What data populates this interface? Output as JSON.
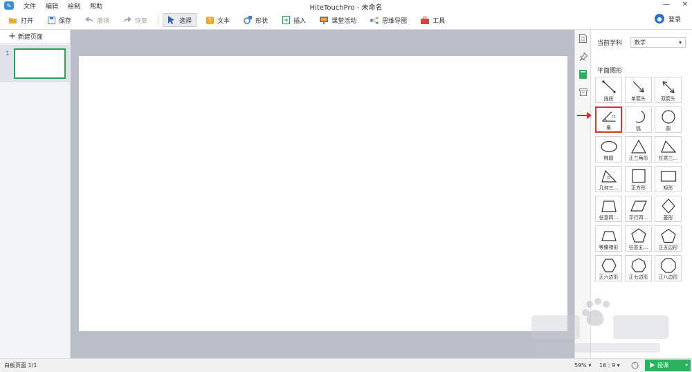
{
  "titlebar": {
    "title": "HiteTouchPro - 未命名",
    "menus": [
      "文件",
      "编辑",
      "绘制",
      "帮助"
    ]
  },
  "toolbar": {
    "open": "打开",
    "save": "保存",
    "undo": "撤销",
    "redo": "恢复",
    "select": "选择",
    "text": "文本",
    "shape": "形状",
    "insert": "插入",
    "activity": "课堂活动",
    "mindmap": "思维导图",
    "tools": "工具",
    "login": "登录"
  },
  "left_panel": {
    "new_page": "新建页面",
    "page_number": "1"
  },
  "right_panel": {
    "subject_label": "当前学科",
    "subject_value": "数学",
    "section_title": "平面图形",
    "shapes": [
      {
        "label": "线段",
        "icon": "segment-icon"
      },
      {
        "label": "单箭头",
        "icon": "single-arrow-icon"
      },
      {
        "label": "双箭头",
        "icon": "double-arrow-icon"
      },
      {
        "label": "角",
        "icon": "angle-icon",
        "selected": true
      },
      {
        "label": "弧",
        "icon": "arc-icon"
      },
      {
        "label": "圆",
        "icon": "circle-icon"
      },
      {
        "label": "椭圆",
        "icon": "ellipse-icon"
      },
      {
        "label": "正三角形",
        "icon": "equilateral-triangle-icon"
      },
      {
        "label": "任意三...",
        "icon": "right-triangle-icon"
      },
      {
        "label": "几何三...",
        "icon": "geometric-triangle-icon"
      },
      {
        "label": "正方形",
        "icon": "square-icon"
      },
      {
        "label": "矩形",
        "icon": "rectangle-icon"
      },
      {
        "label": "任意四...",
        "icon": "quadrilateral-icon"
      },
      {
        "label": "平行四...",
        "icon": "parallelogram-icon"
      },
      {
        "label": "菱形",
        "icon": "rhombus-icon"
      },
      {
        "label": "等腰梯形",
        "icon": "trapezoid-icon"
      },
      {
        "label": "任意五...",
        "icon": "pentagon-icon"
      },
      {
        "label": "正五边形",
        "icon": "regular-pentagon-icon"
      },
      {
        "label": "正六边形",
        "icon": "hexagon-icon"
      },
      {
        "label": "正七边形",
        "icon": "heptagon-icon"
      },
      {
        "label": "正八边形",
        "icon": "octagon-icon"
      }
    ]
  },
  "statusbar": {
    "page_status": "白板页面 1/1",
    "zoom": "59%",
    "ratio": "16 : 9",
    "present": "授课"
  },
  "colors": {
    "accent_green": "#29b35e",
    "selected_red": "#d9362b",
    "canvas_bg": "#b9bec9",
    "brand_blue": "#2b6fcf"
  }
}
